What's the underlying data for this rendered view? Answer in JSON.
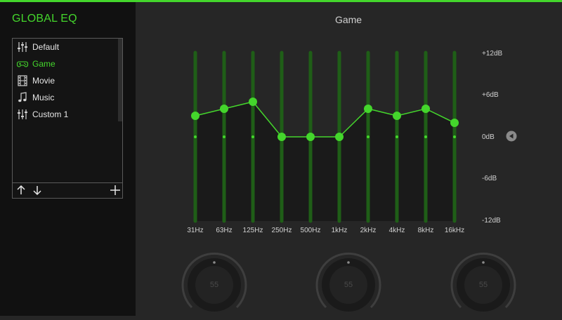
{
  "sidebar": {
    "title": "GLOBAL EQ",
    "presets": [
      {
        "label": "Default",
        "icon": "sliders-icon",
        "active": false
      },
      {
        "label": "Game",
        "icon": "gamepad-icon",
        "active": true
      },
      {
        "label": "Movie",
        "icon": "film-icon",
        "active": false
      },
      {
        "label": "Music",
        "icon": "music-note-icon",
        "active": false
      },
      {
        "label": "Custom 1",
        "icon": "sliders-icon",
        "active": false
      }
    ]
  },
  "eq": {
    "title": "Game",
    "db_labels": [
      "+12dB",
      "+6dB",
      "0dB",
      "-6dB",
      "-12dB"
    ],
    "db_range": [
      -12,
      12
    ],
    "bands": [
      {
        "freq": "31Hz",
        "gain": 3
      },
      {
        "freq": "63Hz",
        "gain": 4
      },
      {
        "freq": "125Hz",
        "gain": 5
      },
      {
        "freq": "250Hz",
        "gain": 0
      },
      {
        "freq": "500Hz",
        "gain": 0
      },
      {
        "freq": "1kHz",
        "gain": 0
      },
      {
        "freq": "2kHz",
        "gain": 4
      },
      {
        "freq": "4kHz",
        "gain": 3
      },
      {
        "freq": "8kHz",
        "gain": 4
      },
      {
        "freq": "16kHz",
        "gain": 2
      }
    ]
  },
  "knobs": [
    {
      "value": "55"
    },
    {
      "value": "55"
    },
    {
      "value": "55"
    }
  ],
  "colors": {
    "accent": "#44d62c",
    "track": "#1f5e17",
    "fill": "#1a1a1a"
  }
}
